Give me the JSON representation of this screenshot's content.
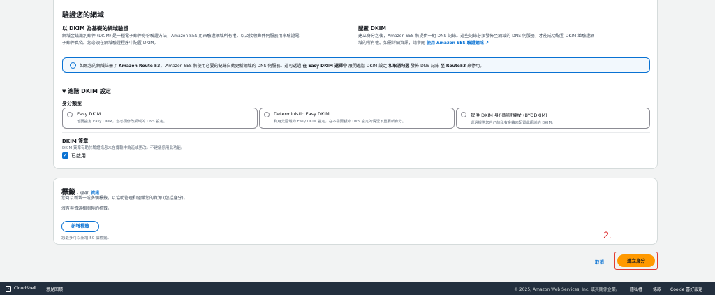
{
  "verify": {
    "title": "驗證您的網域",
    "dkim_heading": "以 DKIM 為基礎的網域驗證",
    "dkim_desc_1": "網域金鑰識別郵件 (DKIM) 是一種電子郵件身份驗證方法，Amazon SES 用來驗證網域所有權，以及接收郵件伺服器用來驗證電",
    "dkim_desc_2": "子郵件真偽。您必須在網域驗證程序中配置 DKIM。",
    "config_heading": "配置 DKIM",
    "config_desc_1": "建立身分之後，Amazon SES 將提供一組 DNS 記錄。這些記錄必須發佈至網域的 DNS 伺服器，才能成功配置 DKIM 並驗證網",
    "config_desc_2": "域的所有權。如需詳細資訊，請參閱",
    "config_link": "使用 Amazon SES 驗證網域",
    "info_text_1": "如果您的網域註冊了",
    "info_bold_1": "Amazon Route 53，",
    "info_text_2": "Amazon SES 將使用必要的紀錄自動更新網域的 DNS 伺服器。這可透過",
    "info_bold_2": "在 Easy DKIM 選擇中",
    "info_text_3": "展開進階 DKIM 設定",
    "info_bold_3": "和取消勾選",
    "info_text_4": "發佈 DNS 記錄",
    "info_bold_4": "至 Route53",
    "info_text_5": "來停用。",
    "advanced_label": "進階 DKIM 設定",
    "identity_type_label": "身分類型",
    "options": [
      {
        "label": "Easy DKIM",
        "desc": "若要設定 Easy DKIM，您必須修改網域的 DNS 設定。"
      },
      {
        "label": "Deterministic Easy DKIM",
        "desc": "利用父區域的 Easy DKIM 設定，在不需要額外 DNS 設定的情況下重要新身分。"
      },
      {
        "label": "提供 DKIM 身份驗證權杖 (BYODKIM)",
        "desc": "透過提供您自己的私有金鑰來配置此網域的 DKIM。"
      }
    ],
    "signature_heading": "DKIM 簽章",
    "signature_desc": "DKIM 簽章有助於驗證訊息未在傳輸中偽造或更改。不建議停用此功能。",
    "enabled_label": "已啟用"
  },
  "tags": {
    "title": "標籤",
    "optional": " - 選用",
    "info_link": "資訊",
    "desc": "您可以新增一或多個標籤，以協助管理和組織您的資源 (包括身分)。",
    "empty": "沒有與資源相關聯的標籤。",
    "add_button": "新增標籤",
    "limit": "您最多可以新增 50 個標籤。"
  },
  "actions": {
    "step_label": "2.",
    "cancel": "取消",
    "create": "建立身分"
  },
  "footer": {
    "cloudshell": "CloudShell",
    "feedback": "意見回饋",
    "copyright": "© 2025, Amazon Web Services, Inc. 或其關係企業。",
    "privacy": "隱私權",
    "terms": "條款",
    "cookie": "Cookie 喜好設定"
  },
  "colors": {
    "accent": "#0972d3",
    "primary_button": "#ff9900",
    "highlight": "#e03c31",
    "footer_bg": "#232f3e"
  }
}
